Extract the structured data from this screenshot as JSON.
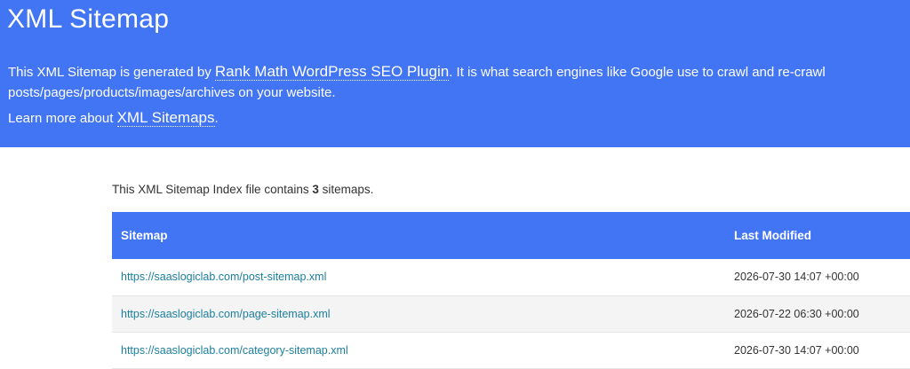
{
  "header": {
    "title": "XML Sitemap",
    "intro_prefix": "This XML Sitemap is generated by ",
    "plugin_link": "Rank Math WordPress SEO Plugin",
    "intro_suffix": ". It is what search engines like Google use to crawl and re-crawl posts/pages/products/images/archives on your website.",
    "learn_prefix": "Learn more about ",
    "learn_link": "XML Sitemaps",
    "learn_suffix": "."
  },
  "summary": {
    "prefix": "This XML Sitemap Index file contains ",
    "count": "3",
    "suffix": " sitemaps."
  },
  "table": {
    "columns": [
      "Sitemap",
      "Last Modified"
    ],
    "rows": [
      {
        "url": "https://saaslogiclab.com/post-sitemap.xml",
        "modified": "2026-07-30 14:07 +00:00"
      },
      {
        "url": "https://saaslogiclab.com/page-sitemap.xml",
        "modified": "2026-07-22 06:30 +00:00"
      },
      {
        "url": "https://saaslogiclab.com/category-sitemap.xml",
        "modified": "2026-07-30 14:07 +00:00"
      }
    ]
  },
  "colors": {
    "brand_blue": "#4275f4",
    "link_teal": "#1c7f9e"
  }
}
